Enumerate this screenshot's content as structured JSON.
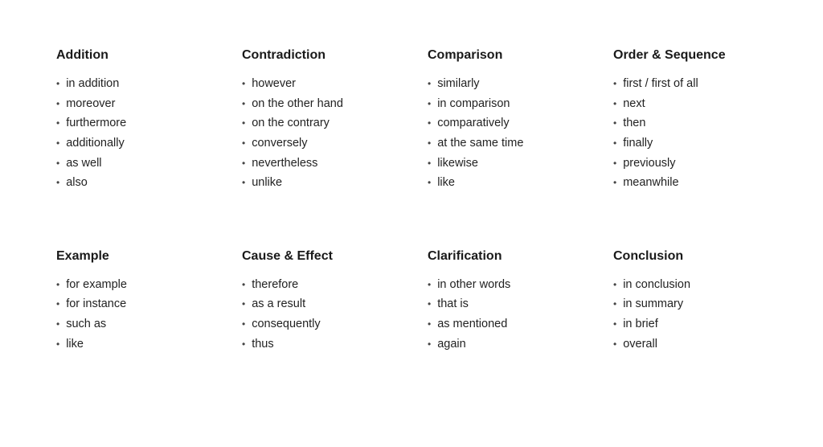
{
  "sections": [
    {
      "id": "addition",
      "title": "Addition",
      "items": [
        "in addition",
        "moreover",
        "furthermore",
        "additionally",
        "as well",
        "also"
      ]
    },
    {
      "id": "contradiction",
      "title": "Contradiction",
      "items": [
        "however",
        "on the other hand",
        "on the contrary",
        "conversely",
        "nevertheless",
        "unlike"
      ]
    },
    {
      "id": "comparison",
      "title": "Comparison",
      "items": [
        "similarly",
        "in comparison",
        "comparatively",
        "at the same time",
        "likewise",
        "like"
      ]
    },
    {
      "id": "order-sequence",
      "title": "Order & Sequence",
      "items": [
        "first / first of all",
        "next",
        "then",
        "finally",
        "previously",
        "meanwhile"
      ]
    },
    {
      "id": "example",
      "title": "Example",
      "items": [
        "for example",
        "for instance",
        "such as",
        "like"
      ]
    },
    {
      "id": "cause-effect",
      "title": "Cause & Effect",
      "items": [
        "therefore",
        "as a result",
        "consequently",
        "thus"
      ]
    },
    {
      "id": "clarification",
      "title": "Clarification",
      "items": [
        "in other words",
        "that is",
        "as mentioned",
        "again"
      ]
    },
    {
      "id": "conclusion",
      "title": "Conclusion",
      "items": [
        "in conclusion",
        "in summary",
        "in brief",
        "overall"
      ]
    }
  ]
}
